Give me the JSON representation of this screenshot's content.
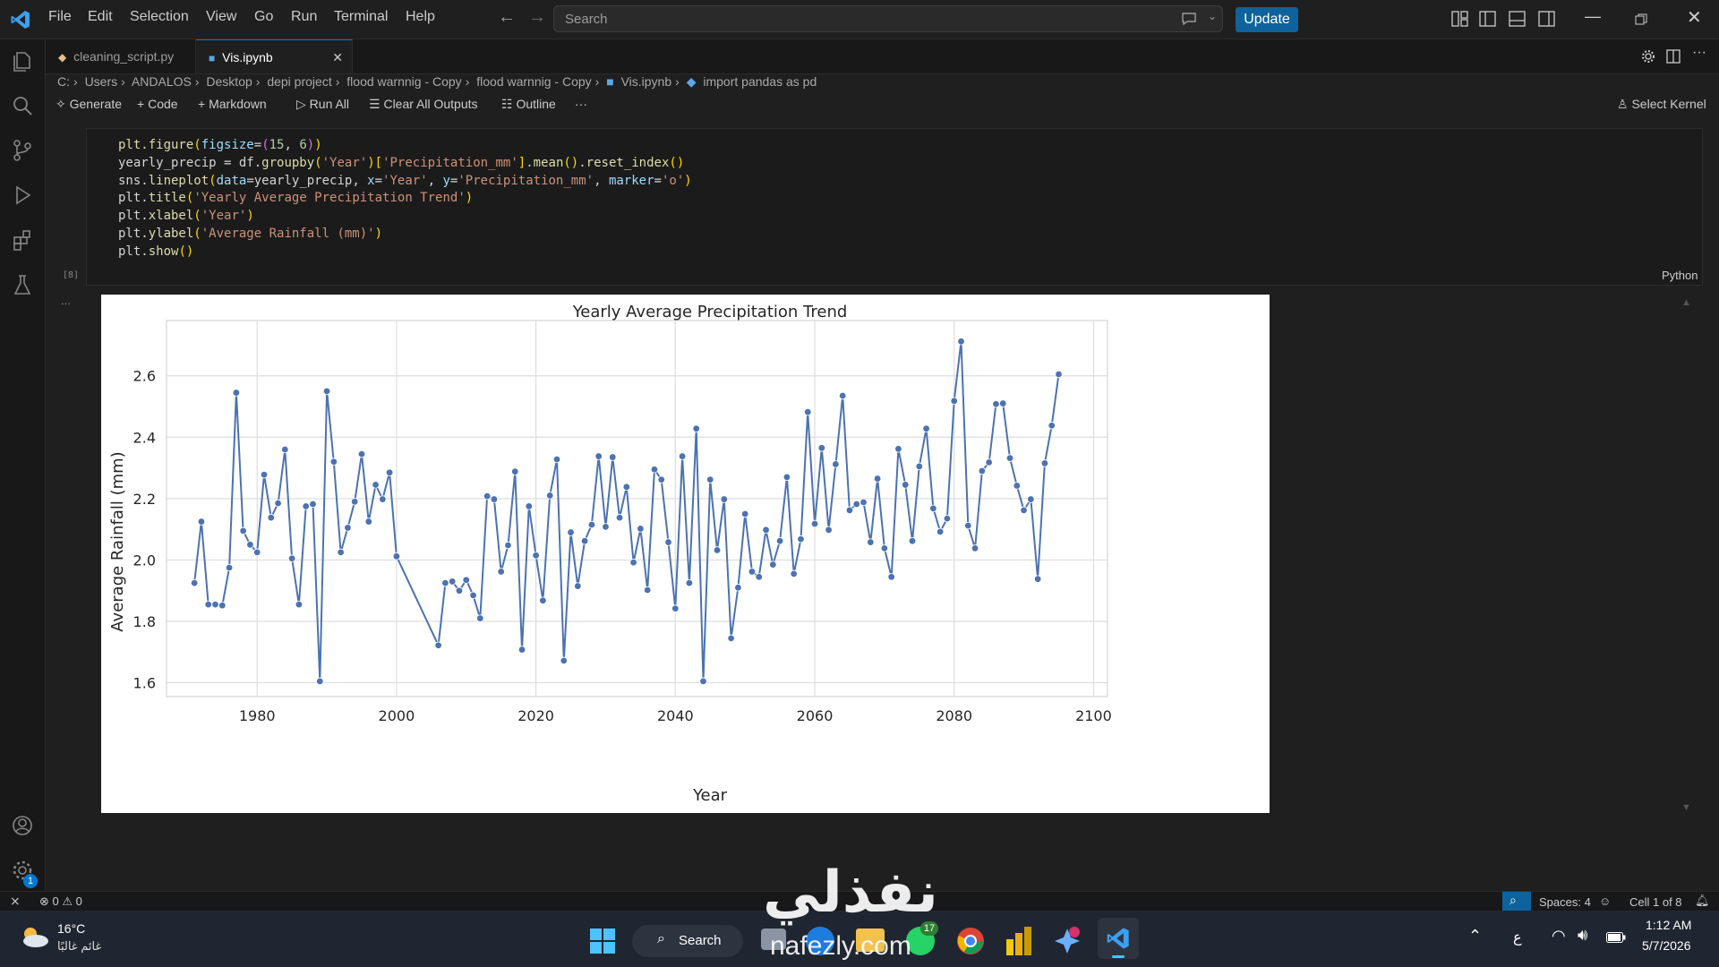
{
  "menu": [
    "File",
    "Edit",
    "Selection",
    "View",
    "Go",
    "Run",
    "Terminal",
    "Help"
  ],
  "search": {
    "placeholder": "Search"
  },
  "update_label": "Update",
  "tabs": [
    {
      "label": "cleaning_script.py",
      "active": false
    },
    {
      "label": "Vis.ipynb",
      "active": true
    }
  ],
  "breadcrumb": [
    "C:",
    "Users",
    "ANDALOS",
    "Desktop",
    "depi project",
    "flood warnnig - Copy",
    "flood warnnig - Copy",
    "Vis.ipynb",
    "import pandas as pd"
  ],
  "toolbar": {
    "generate": "Generate",
    "code": "Code",
    "markdown": "Markdown",
    "run_all": "Run All",
    "clear": "Clear All Outputs",
    "outline": "Outline",
    "more": "···",
    "select_kernel": "Select Kernel"
  },
  "cell": {
    "exec_count": "[8]",
    "language": "Python",
    "code_lines": [
      "plt.figure(figsize=(15, 6))",
      "yearly_precip = df.groupby('Year')['Precipitation_mm'].mean().reset_index()",
      "sns.lineplot(data=yearly_precip, x='Year', y='Precipitation_mm', marker='o')",
      "plt.title('Yearly Average Precipitation Trend')",
      "plt.xlabel('Year')",
      "plt.ylabel('Average Rainfall (mm)')",
      "plt.show()"
    ],
    "output_more": "..."
  },
  "chart_data": {
    "type": "line",
    "title": "Yearly Average Precipitation Trend",
    "xlabel": "Year",
    "ylabel": "Average Rainfall (mm)",
    "xlim": [
      1967,
      2102
    ],
    "ylim": [
      1.555,
      2.78
    ],
    "xticks": [
      1980,
      2000,
      2020,
      2040,
      2060,
      2080,
      2100
    ],
    "yticks": [
      1.6,
      1.8,
      2.0,
      2.2,
      2.4,
      2.6
    ],
    "grid": true,
    "color": "#4c72b0",
    "x": [
      1971,
      1972,
      1973,
      1974,
      1975,
      1976,
      1977,
      1978,
      1979,
      1980,
      1981,
      1982,
      1983,
      1984,
      1985,
      1986,
      1987,
      1988,
      1989,
      1990,
      1991,
      1992,
      1993,
      1994,
      1995,
      1996,
      1997,
      1998,
      1999,
      2000,
      2006,
      2007,
      2008,
      2009,
      2010,
      2011,
      2012,
      2013,
      2014,
      2015,
      2016,
      2017,
      2018,
      2019,
      2020,
      2021,
      2022,
      2023,
      2024,
      2025,
      2026,
      2027,
      2028,
      2029,
      2030,
      2031,
      2032,
      2033,
      2034,
      2035,
      2036,
      2037,
      2038,
      2039,
      2040,
      2041,
      2042,
      2043,
      2044,
      2045,
      2046,
      2047,
      2048,
      2049,
      2050,
      2051,
      2052,
      2053,
      2054,
      2055,
      2056,
      2057,
      2058,
      2059,
      2060,
      2061,
      2062,
      2063,
      2064,
      2065,
      2066,
      2067,
      2068,
      2069,
      2070,
      2071,
      2072,
      2073,
      2074,
      2075,
      2076,
      2077,
      2078,
      2079,
      2080,
      2081,
      2082,
      2083,
      2084,
      2085,
      2086,
      2087,
      2088,
      2089,
      2090,
      2091,
      2092,
      2093,
      2094,
      2095
    ],
    "y": [
      1.925,
      2.125,
      1.855,
      1.855,
      1.852,
      1.975,
      2.545,
      2.095,
      2.05,
      2.025,
      2.278,
      2.138,
      2.185,
      2.36,
      2.005,
      1.855,
      2.175,
      2.182,
      1.605,
      2.55,
      2.32,
      2.025,
      2.105,
      2.19,
      2.345,
      2.125,
      2.245,
      2.198,
      2.285,
      2.012,
      1.722,
      1.925,
      1.93,
      1.9,
      1.935,
      1.885,
      1.81,
      2.208,
      2.198,
      1.962,
      2.048,
      2.288,
      1.708,
      2.175,
      2.015,
      1.868,
      2.21,
      2.328,
      1.672,
      2.09,
      1.915,
      2.062,
      2.115,
      2.338,
      2.108,
      2.335,
      2.138,
      2.238,
      1.992,
      2.102,
      1.902,
      2.295,
      2.262,
      2.058,
      1.842,
      2.338,
      1.925,
      2.428,
      1.605,
      2.262,
      2.032,
      2.198,
      1.745,
      1.91,
      2.15,
      1.962,
      1.945,
      2.098,
      1.985,
      2.062,
      2.27,
      1.955,
      2.068,
      2.482,
      2.118,
      2.365,
      2.098,
      2.312,
      2.535,
      2.162,
      2.182,
      2.188,
      2.058,
      2.265,
      2.038,
      1.945,
      2.362,
      2.245,
      2.062,
      2.305,
      2.428,
      2.168,
      2.092,
      2.135,
      2.518,
      2.712,
      2.112,
      2.038,
      2.29,
      2.318,
      2.508,
      2.51,
      2.332,
      2.242,
      2.162,
      2.198,
      1.938,
      2.315,
      2.438,
      2.605
    ]
  },
  "status": {
    "errors": "0",
    "warnings": "0",
    "spaces": "Spaces: 4",
    "cell": "Cell 1 of 8"
  },
  "taskbar": {
    "weather_temp": "16°C",
    "weather_desc": "غائم غالبًا",
    "search_label": "Search",
    "time": "1:12 AM",
    "date": "5/7/2026",
    "lang": "ع",
    "badge_whatsapp": "17",
    "badge_settings": "1"
  },
  "watermark": {
    "arabic": "نفذلي",
    "latin": "nafezly.com"
  },
  "colors": {
    "accent": "#0078d4",
    "update": "#0e639c",
    "line": "#4c72b0"
  }
}
